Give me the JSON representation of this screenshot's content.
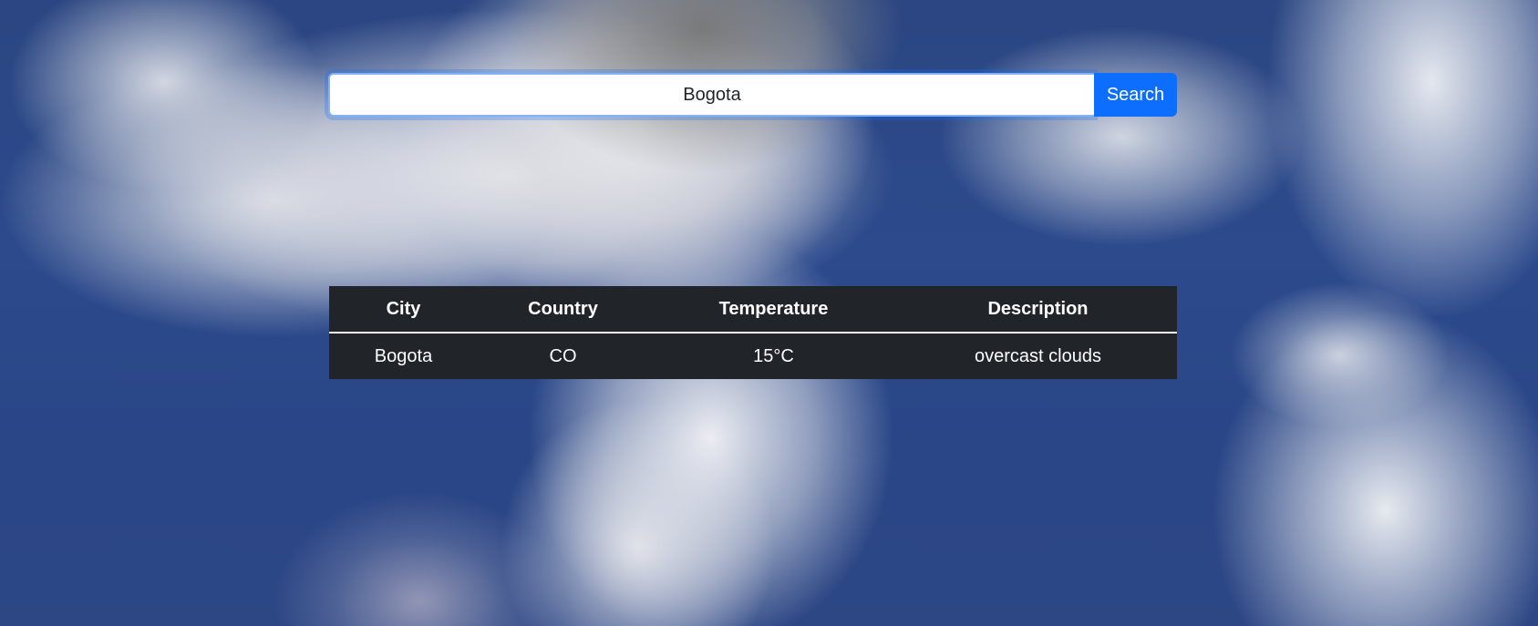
{
  "search": {
    "value": "Bogota",
    "button_label": "Search"
  },
  "table": {
    "headers": [
      "City",
      "Country",
      "Temperature",
      "Description"
    ],
    "rows": [
      {
        "city": "Bogota",
        "country": "CO",
        "temperature": "15°C",
        "description": "overcast clouds"
      }
    ]
  },
  "colors": {
    "button": "#0d6efd",
    "table_background": "#212529",
    "sky": "#2c4a8c"
  }
}
